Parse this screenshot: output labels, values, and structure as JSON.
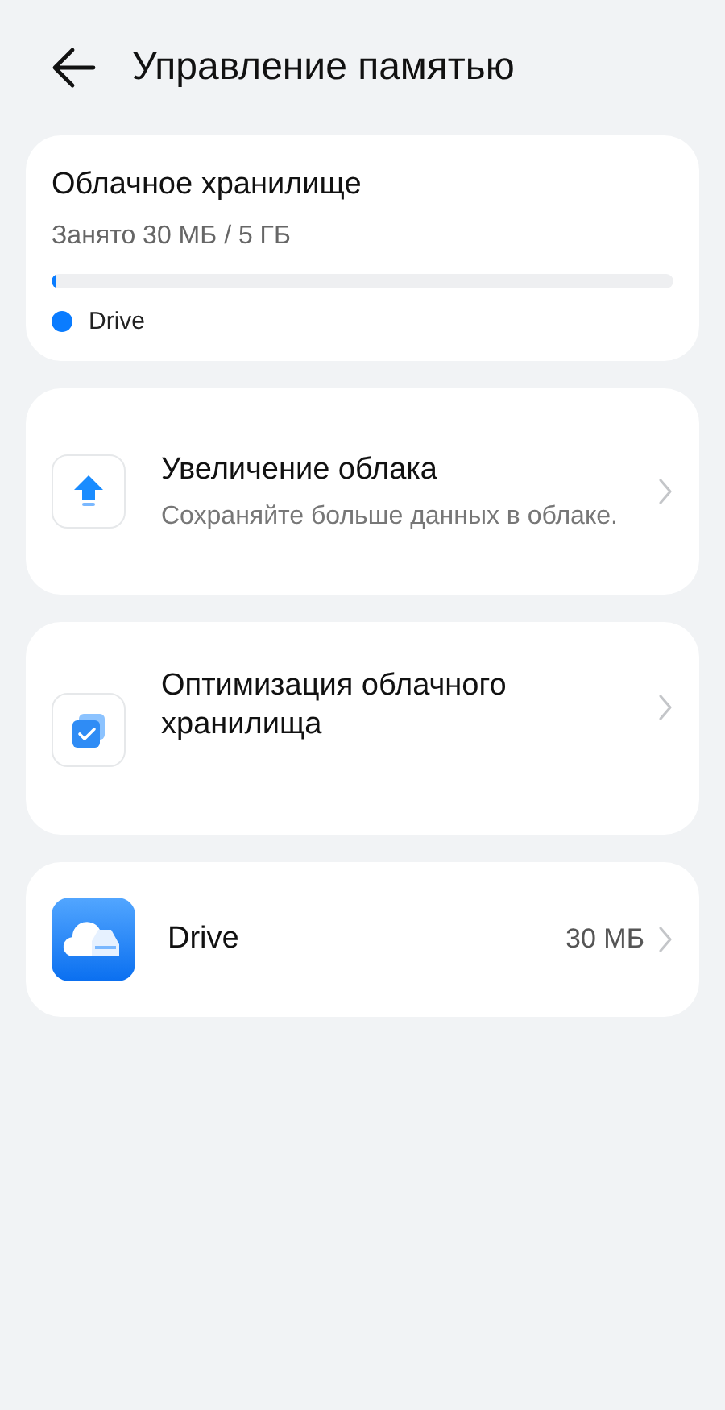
{
  "header": {
    "title": "Управление памятью"
  },
  "storage": {
    "title": "Облачное хранилище",
    "usage": "Занято 30 МБ / 5 ГБ",
    "level": 0.006,
    "legend": [
      {
        "label": "Drive",
        "color": "#0a7cff"
      }
    ]
  },
  "items": [
    {
      "kind": "upload",
      "title": "Увеличение облака",
      "subtitle": "Сохраняйте больше данных в облаке."
    },
    {
      "kind": "optimize",
      "title": "Оптимизация облачного хранилища"
    },
    {
      "kind": "app",
      "title": "Drive",
      "value": "30 МБ"
    }
  ]
}
